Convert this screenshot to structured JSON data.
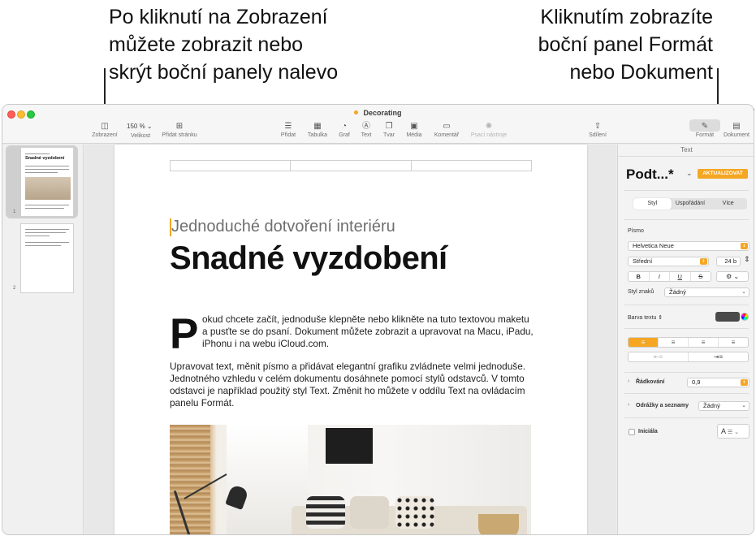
{
  "callouts": {
    "left": "Po kliknutí na Zobrazení\nmůžete zobrazit nebo\nskrýt boční panely nalevo",
    "right": "Kliknutím zobrazíte\nboční panel Formát\nnebo Dokument"
  },
  "window": {
    "title": "Decorating"
  },
  "toolbar": {
    "view_label": "Zobrazení",
    "zoom_value": "150 %",
    "zoom_label": "Velikost",
    "add_page_label": "Přidat stránku",
    "insert_label": "Přidat",
    "table_label": "Tabulka",
    "chart_label": "Graf",
    "text_label": "Text",
    "shape_label": "Tvar",
    "media_label": "Média",
    "comment_label": "Komentář",
    "writing_tools_label": "Psací nástroje",
    "share_label": "Sdílení",
    "format_label": "Formát",
    "document_label": "Dokument"
  },
  "thumbnails": [
    {
      "number": "1",
      "mini_title": "Snadné vyzdobení"
    },
    {
      "number": "2"
    }
  ],
  "document": {
    "subtitle": "Jednoduché dotvoření interiéru",
    "headline": "Snadné vyzdobení",
    "dropcap": "P",
    "para1": "okud chcete začít, jednoduše klepněte nebo klikněte na tuto textovou maketu a pusťte se do psaní. Dokument můžete zobrazit a upravovat na Macu, iPadu, iPhonu i na webu iCloud.com.",
    "para2": "Upravovat text, měnit písmo a přidávat elegantní grafiku zvládnete velmi jednoduše. Jednotného vzhledu v celém dokumentu dosáhnete pomocí stylů odstavců. V tomto odstavci je například použitý styl Text. Změnit ho můžete v oddílu Text na ovládacím panelu Formát."
  },
  "inspector": {
    "header": "Text",
    "style_name": "Podt...*",
    "update_button": "AKTUALIZOVAT",
    "tabs": [
      "Styl",
      "Uspořádání",
      "Více"
    ],
    "font_section": "Písmo",
    "font_family": "Helvetica Neue",
    "font_weight": "Střední",
    "font_size": "24 b",
    "bold": "B",
    "italic": "I",
    "underline": "U",
    "strike": "S",
    "char_style_label": "Styl znaků",
    "char_style_value": "Žádný",
    "text_color_label": "Barva textu",
    "line_spacing_label": "Řádkování",
    "line_spacing_value": "0,9",
    "bullets_label": "Odrážky a seznamy",
    "bullets_value": "Žádný",
    "dropcap_label": "Iniciála",
    "dropcap_sample": "A"
  },
  "colors": {
    "accent": "#f5a623",
    "close": "#ff5f57",
    "minimize": "#febc2e",
    "zoom": "#28c840"
  }
}
